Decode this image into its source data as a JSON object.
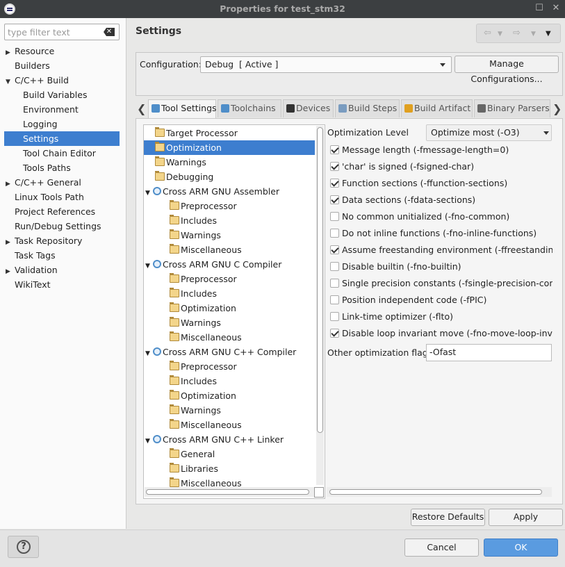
{
  "window": {
    "title": "Properties for test_stm32"
  },
  "filter": {
    "placeholder": "type filter text"
  },
  "sidebar": {
    "items": [
      {
        "label": "Resource",
        "indent": 0,
        "arrow": "right"
      },
      {
        "label": "Builders",
        "indent": 0,
        "arrow": ""
      },
      {
        "label": "C/C++ Build",
        "indent": 0,
        "arrow": "down"
      },
      {
        "label": "Build Variables",
        "indent": 1,
        "arrow": ""
      },
      {
        "label": "Environment",
        "indent": 1,
        "arrow": ""
      },
      {
        "label": "Logging",
        "indent": 1,
        "arrow": ""
      },
      {
        "label": "Settings",
        "indent": 1,
        "arrow": "",
        "selected": true
      },
      {
        "label": "Tool Chain Editor",
        "indent": 1,
        "arrow": ""
      },
      {
        "label": "Tools Paths",
        "indent": 1,
        "arrow": ""
      },
      {
        "label": "C/C++ General",
        "indent": 0,
        "arrow": "right"
      },
      {
        "label": "Linux Tools Path",
        "indent": 0,
        "arrow": ""
      },
      {
        "label": "Project References",
        "indent": 0,
        "arrow": ""
      },
      {
        "label": "Run/Debug Settings",
        "indent": 0,
        "arrow": ""
      },
      {
        "label": "Task Repository",
        "indent": 0,
        "arrow": "right"
      },
      {
        "label": "Task Tags",
        "indent": 0,
        "arrow": ""
      },
      {
        "label": "Validation",
        "indent": 0,
        "arrow": "right"
      },
      {
        "label": "WikiText",
        "indent": 0,
        "arrow": ""
      }
    ]
  },
  "header": {
    "title": "Settings"
  },
  "config": {
    "label": "Configuration:",
    "value": "Debug  [ Active ]",
    "manage_label": "Manage Configurations..."
  },
  "tabs": [
    {
      "label": "Tool Settings",
      "active": true,
      "icon": "tool-settings-icon",
      "color": "#4f8ec9"
    },
    {
      "label": "Toolchains",
      "active": false,
      "icon": "toolchains-icon",
      "color": "#4f8ec9"
    },
    {
      "label": "Devices",
      "active": false,
      "icon": "devices-icon",
      "color": "#333333"
    },
    {
      "label": "Build Steps",
      "active": false,
      "icon": "build-steps-icon",
      "color": "#7a9cc0"
    },
    {
      "label": "Build Artifact",
      "active": false,
      "icon": "build-artifact-icon",
      "color": "#e0a020"
    },
    {
      "label": "Binary Parsers",
      "active": false,
      "icon": "binary-parsers-icon",
      "color": "#666666"
    }
  ],
  "tree": [
    {
      "label": "Target Processor",
      "level": 0,
      "type": "folder"
    },
    {
      "label": "Optimization",
      "level": 0,
      "type": "folder",
      "selected": true
    },
    {
      "label": "Warnings",
      "level": 0,
      "type": "folder"
    },
    {
      "label": "Debugging",
      "level": 0,
      "type": "folder"
    },
    {
      "label": "Cross ARM GNU Assembler",
      "level": 0,
      "type": "tool",
      "expanded": true
    },
    {
      "label": "Preprocessor",
      "level": 1,
      "type": "folder"
    },
    {
      "label": "Includes",
      "level": 1,
      "type": "folder"
    },
    {
      "label": "Warnings",
      "level": 1,
      "type": "folder"
    },
    {
      "label": "Miscellaneous",
      "level": 1,
      "type": "folder"
    },
    {
      "label": "Cross ARM GNU C Compiler",
      "level": 0,
      "type": "tool",
      "expanded": true
    },
    {
      "label": "Preprocessor",
      "level": 1,
      "type": "folder"
    },
    {
      "label": "Includes",
      "level": 1,
      "type": "folder"
    },
    {
      "label": "Optimization",
      "level": 1,
      "type": "folder"
    },
    {
      "label": "Warnings",
      "level": 1,
      "type": "folder"
    },
    {
      "label": "Miscellaneous",
      "level": 1,
      "type": "folder"
    },
    {
      "label": "Cross ARM GNU C++ Compiler",
      "level": 0,
      "type": "tool",
      "expanded": true
    },
    {
      "label": "Preprocessor",
      "level": 1,
      "type": "folder"
    },
    {
      "label": "Includes",
      "level": 1,
      "type": "folder"
    },
    {
      "label": "Optimization",
      "level": 1,
      "type": "folder"
    },
    {
      "label": "Warnings",
      "level": 1,
      "type": "folder"
    },
    {
      "label": "Miscellaneous",
      "level": 1,
      "type": "folder"
    },
    {
      "label": "Cross ARM GNU C++ Linker",
      "level": 0,
      "type": "tool",
      "expanded": true
    },
    {
      "label": "General",
      "level": 1,
      "type": "folder"
    },
    {
      "label": "Libraries",
      "level": 1,
      "type": "folder"
    },
    {
      "label": "Miscellaneous",
      "level": 1,
      "type": "folder"
    }
  ],
  "optimization": {
    "level_label": "Optimization Level",
    "level_value": "Optimize most (-O3)",
    "options": [
      {
        "label": "Message length (-fmessage-length=0)",
        "checked": true
      },
      {
        "label": "'char' is signed (-fsigned-char)",
        "checked": true
      },
      {
        "label": "Function sections (-ffunction-sections)",
        "checked": true
      },
      {
        "label": "Data sections (-fdata-sections)",
        "checked": true
      },
      {
        "label": "No common unitialized (-fno-common)",
        "checked": false
      },
      {
        "label": "Do not inline functions (-fno-inline-functions)",
        "checked": false
      },
      {
        "label": "Assume freestanding environment (-ffreestanding)",
        "checked": true
      },
      {
        "label": "Disable builtin (-fno-builtin)",
        "checked": false
      },
      {
        "label": "Single precision constants (-fsingle-precision-constant",
        "checked": false
      },
      {
        "label": "Position independent code (-fPIC)",
        "checked": false
      },
      {
        "label": "Link-time optimizer (-flto)",
        "checked": false
      },
      {
        "label": "Disable loop invariant move (-fno-move-loop-invariant",
        "checked": true
      }
    ],
    "other_label": "Other optimization flags",
    "other_value": "-Ofast"
  },
  "buttons": {
    "restore": "Restore Defaults",
    "apply": "Apply",
    "cancel": "Cancel",
    "ok": "OK",
    "help": "?"
  },
  "colors": {
    "selection": "#3d7ecf",
    "ok_button": "#5a9be0",
    "titlebar": "#3c3f41"
  }
}
